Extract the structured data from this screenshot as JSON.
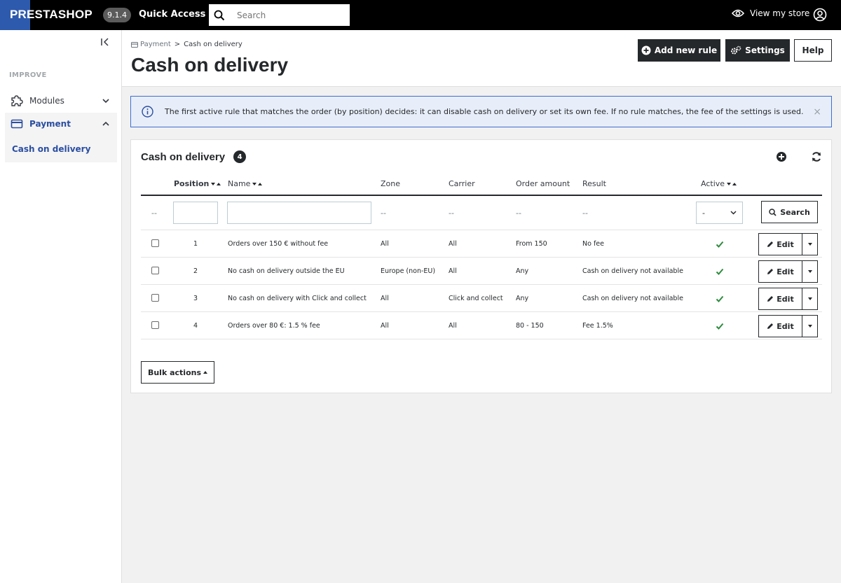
{
  "topbar": {
    "logo_text": "PRESTASHOP",
    "version": "9.1.4",
    "quick_access": "Quick Access",
    "search_placeholder": "Search",
    "view_store": "View my store"
  },
  "sidebar": {
    "section_label": "IMPROVE",
    "items": [
      {
        "label": "Modules"
      },
      {
        "label": "Payment"
      }
    ],
    "sub_item": "Cash on delivery"
  },
  "header": {
    "breadcrumb_parent": "Payment",
    "breadcrumb_sep": ">",
    "breadcrumb_current": "Cash on delivery",
    "title": "Cash on delivery",
    "btn_add": "Add new rule",
    "btn_settings": "Settings",
    "btn_help": "Help"
  },
  "alert": {
    "text": "The first active rule that matches the order (by position) decides: it can disable cash on delivery or set its own fee. If no rule matches, the fee of the settings is used.",
    "close": "×"
  },
  "panel": {
    "title": "Cash on delivery",
    "count": "4",
    "columns": {
      "position": "Position",
      "name": "Name",
      "zone": "Zone",
      "carrier": "Carrier",
      "order_amount": "Order amount",
      "result": "Result",
      "active": "Active"
    },
    "filter_dash": "--",
    "filter_select": "-",
    "search_btn": "Search",
    "edit_label": "Edit",
    "bulk_label": "Bulk actions",
    "rows": [
      {
        "position": "1",
        "name": "Orders over 150 € without fee",
        "zone": "All",
        "carrier": "All",
        "amount": "From 150",
        "result": "No fee"
      },
      {
        "position": "2",
        "name": "No cash on delivery outside the EU",
        "zone": "Europe (non-EU)",
        "carrier": "All",
        "amount": "Any",
        "result": "Cash on delivery not available"
      },
      {
        "position": "3",
        "name": "No cash on delivery with Click and collect",
        "zone": "All",
        "carrier": "Click and collect",
        "amount": "Any",
        "result": "Cash on delivery not available"
      },
      {
        "position": "4",
        "name": "Orders over 80 €: 1.5 % fee",
        "zone": "All",
        "carrier": "All",
        "amount": "80 - 150",
        "result": "Fee 1.5%"
      }
    ]
  },
  "colors": {
    "topbar": "#000000",
    "brand_blue": "#2e5aad",
    "accent": "#2a4ea1",
    "active_check": "#2e8b3e"
  }
}
